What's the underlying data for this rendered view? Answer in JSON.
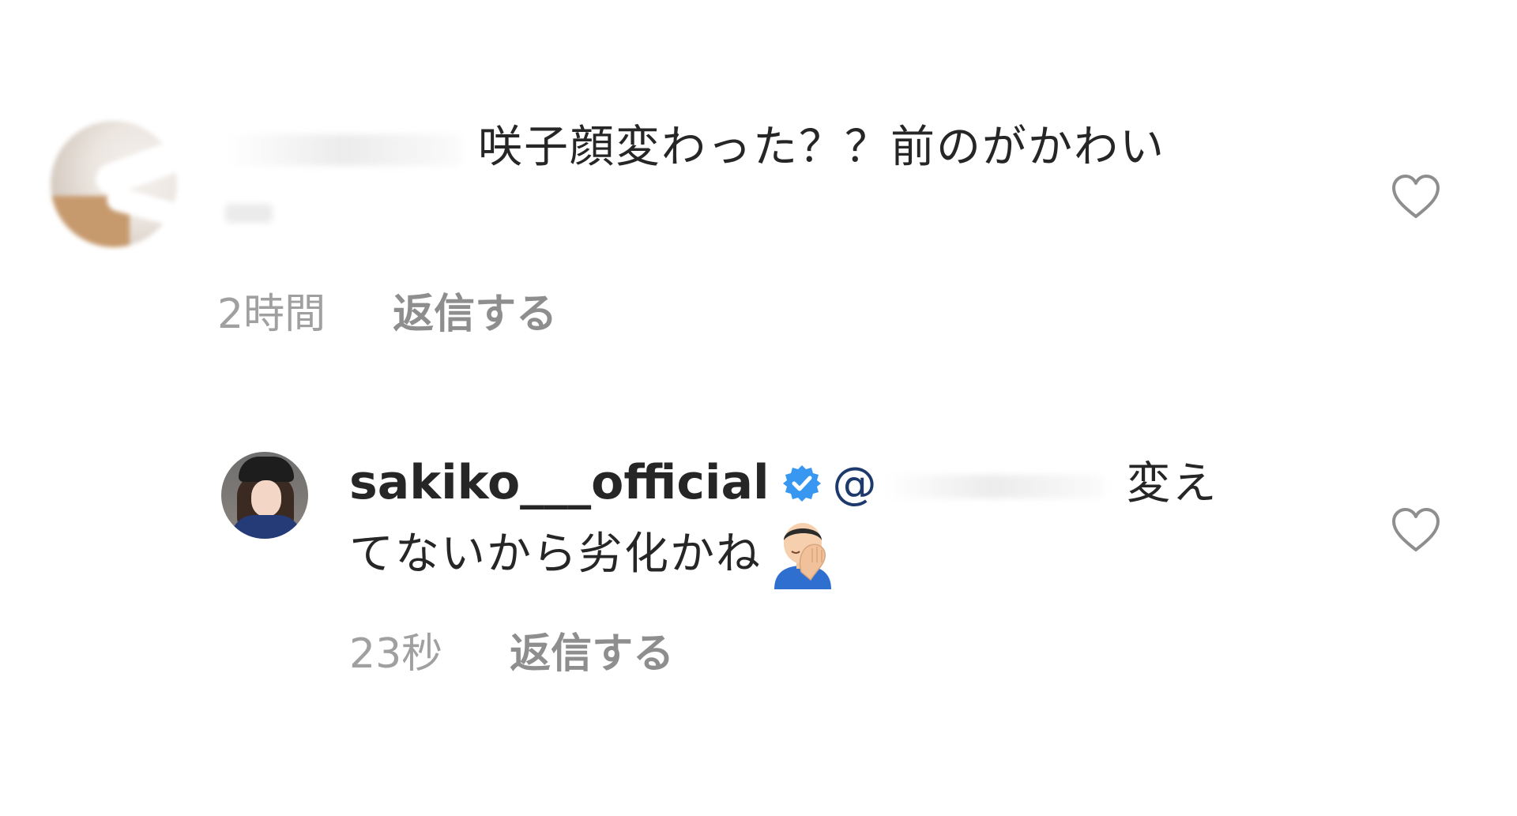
{
  "comments": [
    {
      "text": "咲子顔変わった？？前のがかわい",
      "time": "2時間",
      "reply_label": "返信する",
      "icons": {
        "like": "heart-outline-icon"
      }
    },
    {
      "username": "sakiko___official",
      "verified": true,
      "mention_prefix": "@",
      "text_line1": "変え",
      "text_line2": "てないから劣化かね",
      "time": "23秒",
      "reply_label": "返信する",
      "icons": {
        "verified": "verified-badge-icon",
        "emoji": "facepalm-emoji-icon",
        "like": "heart-outline-icon"
      }
    }
  ],
  "colors": {
    "text": "#262626",
    "meta": "#a0a0a0",
    "verified": "#3897f0",
    "mention": "#1e3a6d"
  }
}
